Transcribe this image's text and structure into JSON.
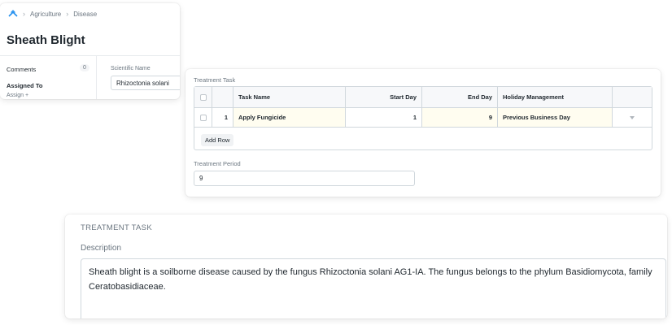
{
  "doc": {
    "breadcrumb": [
      "Agriculture",
      "Disease"
    ],
    "title": "Sheath Blight",
    "comments_label": "Comments",
    "comments_count": "0",
    "assigned_to_label": "Assigned To",
    "assign_link": "Assign +",
    "scientific_name_label": "Scientific Name",
    "scientific_name_value": "Rhizoctonia solani"
  },
  "treatment_table": {
    "section_label": "Treatment Task",
    "columns": [
      "Task Name",
      "Start Day",
      "End Day",
      "Holiday Management"
    ],
    "rows": [
      {
        "idx": "1",
        "task_name": "Apply Fungicide",
        "start_day": "1",
        "end_day": "9",
        "holiday": "Previous Business Day"
      }
    ],
    "add_row_label": "Add Row",
    "period_label": "Treatment Period",
    "period_value": "9"
  },
  "description_section": {
    "heading": "TREATMENT TASK",
    "label": "Description",
    "text": "Sheath blight is a soilborne disease caused by the fungus Rhizoctonia solani AG1-IA. The fungus belongs to the phylum Basidiomycota, family Ceratobasidiaceae."
  },
  "icons": {
    "home": "app-home-icon",
    "breadcrumb_separator": "chevron-right-icon",
    "row_menu": "chevron-down-icon"
  }
}
